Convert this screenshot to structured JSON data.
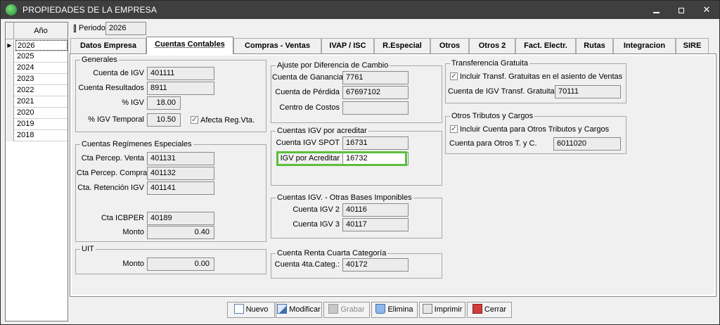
{
  "window": {
    "title": "PROPIEDADES DE LA EMPRESA"
  },
  "years": {
    "header": "Año",
    "items": [
      "2026",
      "2025",
      "2024",
      "2023",
      "2022",
      "2021",
      "2020",
      "2019",
      "2018"
    ],
    "selected_indicator": "▶"
  },
  "periodo": {
    "label": "Periodo",
    "value": "2026"
  },
  "tabs": [
    "Datos Empresa",
    "Cuentas Contables",
    "Compras - Ventas",
    "IVAP / ISC",
    "R.Especial",
    "Otros",
    "Otros 2",
    "Fact. Electr.",
    "Rutas",
    "Integracion",
    "SIRE"
  ],
  "generales": {
    "title": "Generales",
    "cuenta_igv_label": "Cuenta de IGV",
    "cuenta_igv": "401111",
    "cuenta_resultados_label": "Cuenta Resultados",
    "cuenta_resultados": "8911",
    "pct_igv_label": "% IGV",
    "pct_igv": "18.00",
    "pct_igv_temporal_label": "% IGV Temporal",
    "pct_igv_temporal": "10.50",
    "afecta_label": "Afecta Reg.Vta.",
    "afecta_checked": "✓"
  },
  "regimenes": {
    "title": "Cuentas Regímenes Especiales",
    "percep_venta_label": "Cta Percep. Venta",
    "percep_venta": "401131",
    "percep_compra_label": "Cta Percep. Compra",
    "percep_compra": "401132",
    "retencion_label": "Cta. Retención IGV",
    "retencion": "401141",
    "icbper_label": "Cta ICBPER",
    "icbper": "40189",
    "monto_label": "Monto",
    "monto": "0.40"
  },
  "uit": {
    "title": "UIT",
    "monto_label": "Monto",
    "monto": "0.00"
  },
  "ajuste": {
    "title": "Ajuste por Diferencia de Cambio",
    "ganancia_label": "Cuenta de Ganancia",
    "ganancia": "7761",
    "perdida_label": "Cuenta de Pérdida",
    "perdida": "67697102",
    "costos_label": "Centro de Costos",
    "costos": ""
  },
  "igv_acreditar": {
    "title": "Cuentas IGV por acreditar",
    "spot_label": "Cuenta IGV SPOT",
    "spot": "16731",
    "acreditar_label": "IGV por Acreditar",
    "acreditar": "16732"
  },
  "otras_bases": {
    "title": "Cuentas IGV. - Otras Bases Imponibles",
    "igv2_label": "Cuenta IGV 2",
    "igv2": "40116",
    "igv3_label": "Cuenta IGV 3",
    "igv3": "40117"
  },
  "renta_cuarta": {
    "title": "Cuenta Renta Cuarta Categoría",
    "cuenta_label": "Cuenta 4ta.Categ.:",
    "cuenta": "40172"
  },
  "transferencia": {
    "title": "Transferencia Gratuita",
    "incluir_label": "Incluir Transf. Gratuitas en el asiento de Ventas",
    "incluir_checked": "✓",
    "cuenta_label": "Cuenta de IGV Transf. Gratuita",
    "cuenta": "70111"
  },
  "otros_tributos": {
    "title": "Otros Tributos y Cargos",
    "incluir_label": "Incluir Cuenta para Otros Tributos y Cargos",
    "incluir_checked": "✓",
    "cuenta_label": "Cuenta para Otros T. y C.",
    "cuenta": "6011020"
  },
  "buttons": {
    "nuevo": "Nuevo",
    "modificar": "Modificar",
    "grabar": "Grabar",
    "elimina": "Elimina",
    "imprimir": "Imprimir",
    "cerrar": "Cerrar"
  }
}
